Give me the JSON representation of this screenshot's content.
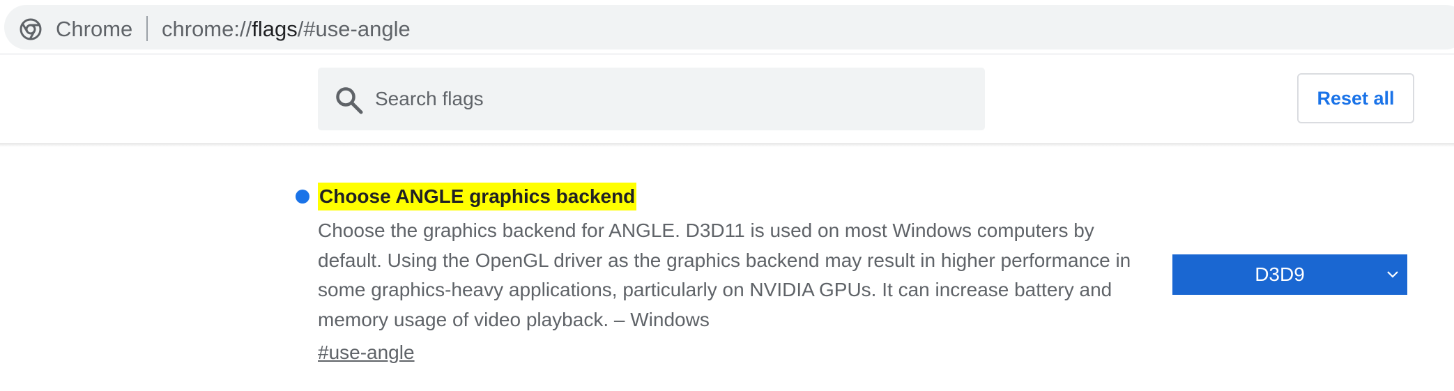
{
  "omnibox": {
    "site_name": "Chrome",
    "url_prefix": "chrome://",
    "url_host": "flags",
    "url_suffix": "/#use-angle"
  },
  "header": {
    "search_placeholder": "Search flags",
    "search_value": "",
    "reset_label": "Reset all"
  },
  "experiment": {
    "title": "Choose ANGLE graphics backend",
    "description": "Choose the graphics backend for ANGLE. D3D11 is used on most Windows computers by default. Using the OpenGL driver as the graphics backend may result in higher performance in some graphics-heavy applications, particularly on NVIDIA GPUs. It can increase battery and memory usage of video playback. – Windows",
    "permalink": "#use-angle",
    "selected_option": "D3D9"
  },
  "icons": {
    "omnibox_icon": "chrome-logo-icon",
    "search_icon": "search-icon",
    "select_icon": "chevron-down-icon",
    "modified_indicator": "dot-icon"
  },
  "colors": {
    "accent_blue": "#1a73e8",
    "select_background": "#1a67d2",
    "title_highlight": "#ffff00"
  }
}
